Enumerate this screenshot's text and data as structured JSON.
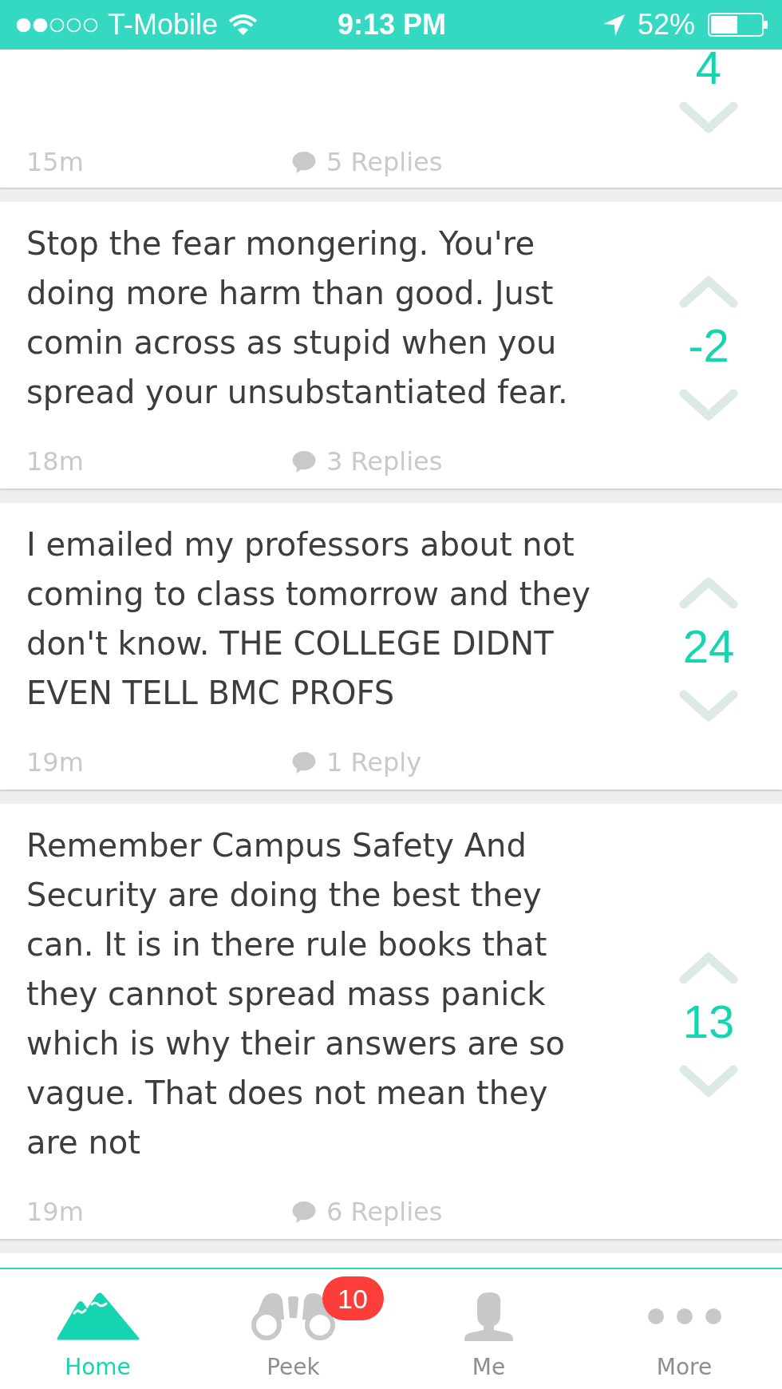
{
  "status_bar": {
    "carrier": "T-Mobile",
    "time": "9:13 PM",
    "battery": "52%"
  },
  "posts": [
    {
      "kind": "clipped",
      "score": "4",
      "time": "15m",
      "replies": "5 Replies"
    },
    {
      "kind": "full",
      "text": "Stop the fear mongering. You're doing more harm than good. Just comin across as stupid when you spread your unsubstantiated fear.",
      "score": "-2",
      "time": "18m",
      "replies": "3 Replies"
    },
    {
      "kind": "full",
      "text": "I emailed my professors about not coming to class tomorrow and they don't know. THE COLLEGE DIDNT EVEN TELL BMC PROFS",
      "score": "24",
      "time": "19m",
      "replies": "1 Reply"
    },
    {
      "kind": "full",
      "text": "Remember Campus Safety And Security are doing the best they can. It is in there rule books that they cannot spread mass panick which is why their answers are so vague. That does not mean they are not",
      "score": "13",
      "time": "19m",
      "replies": "6 Replies"
    }
  ],
  "tabs": [
    {
      "label": "Home",
      "selected": true
    },
    {
      "label": "Peek",
      "selected": false,
      "badge": "10"
    },
    {
      "label": "Me",
      "selected": false
    },
    {
      "label": "More",
      "selected": false
    }
  ]
}
